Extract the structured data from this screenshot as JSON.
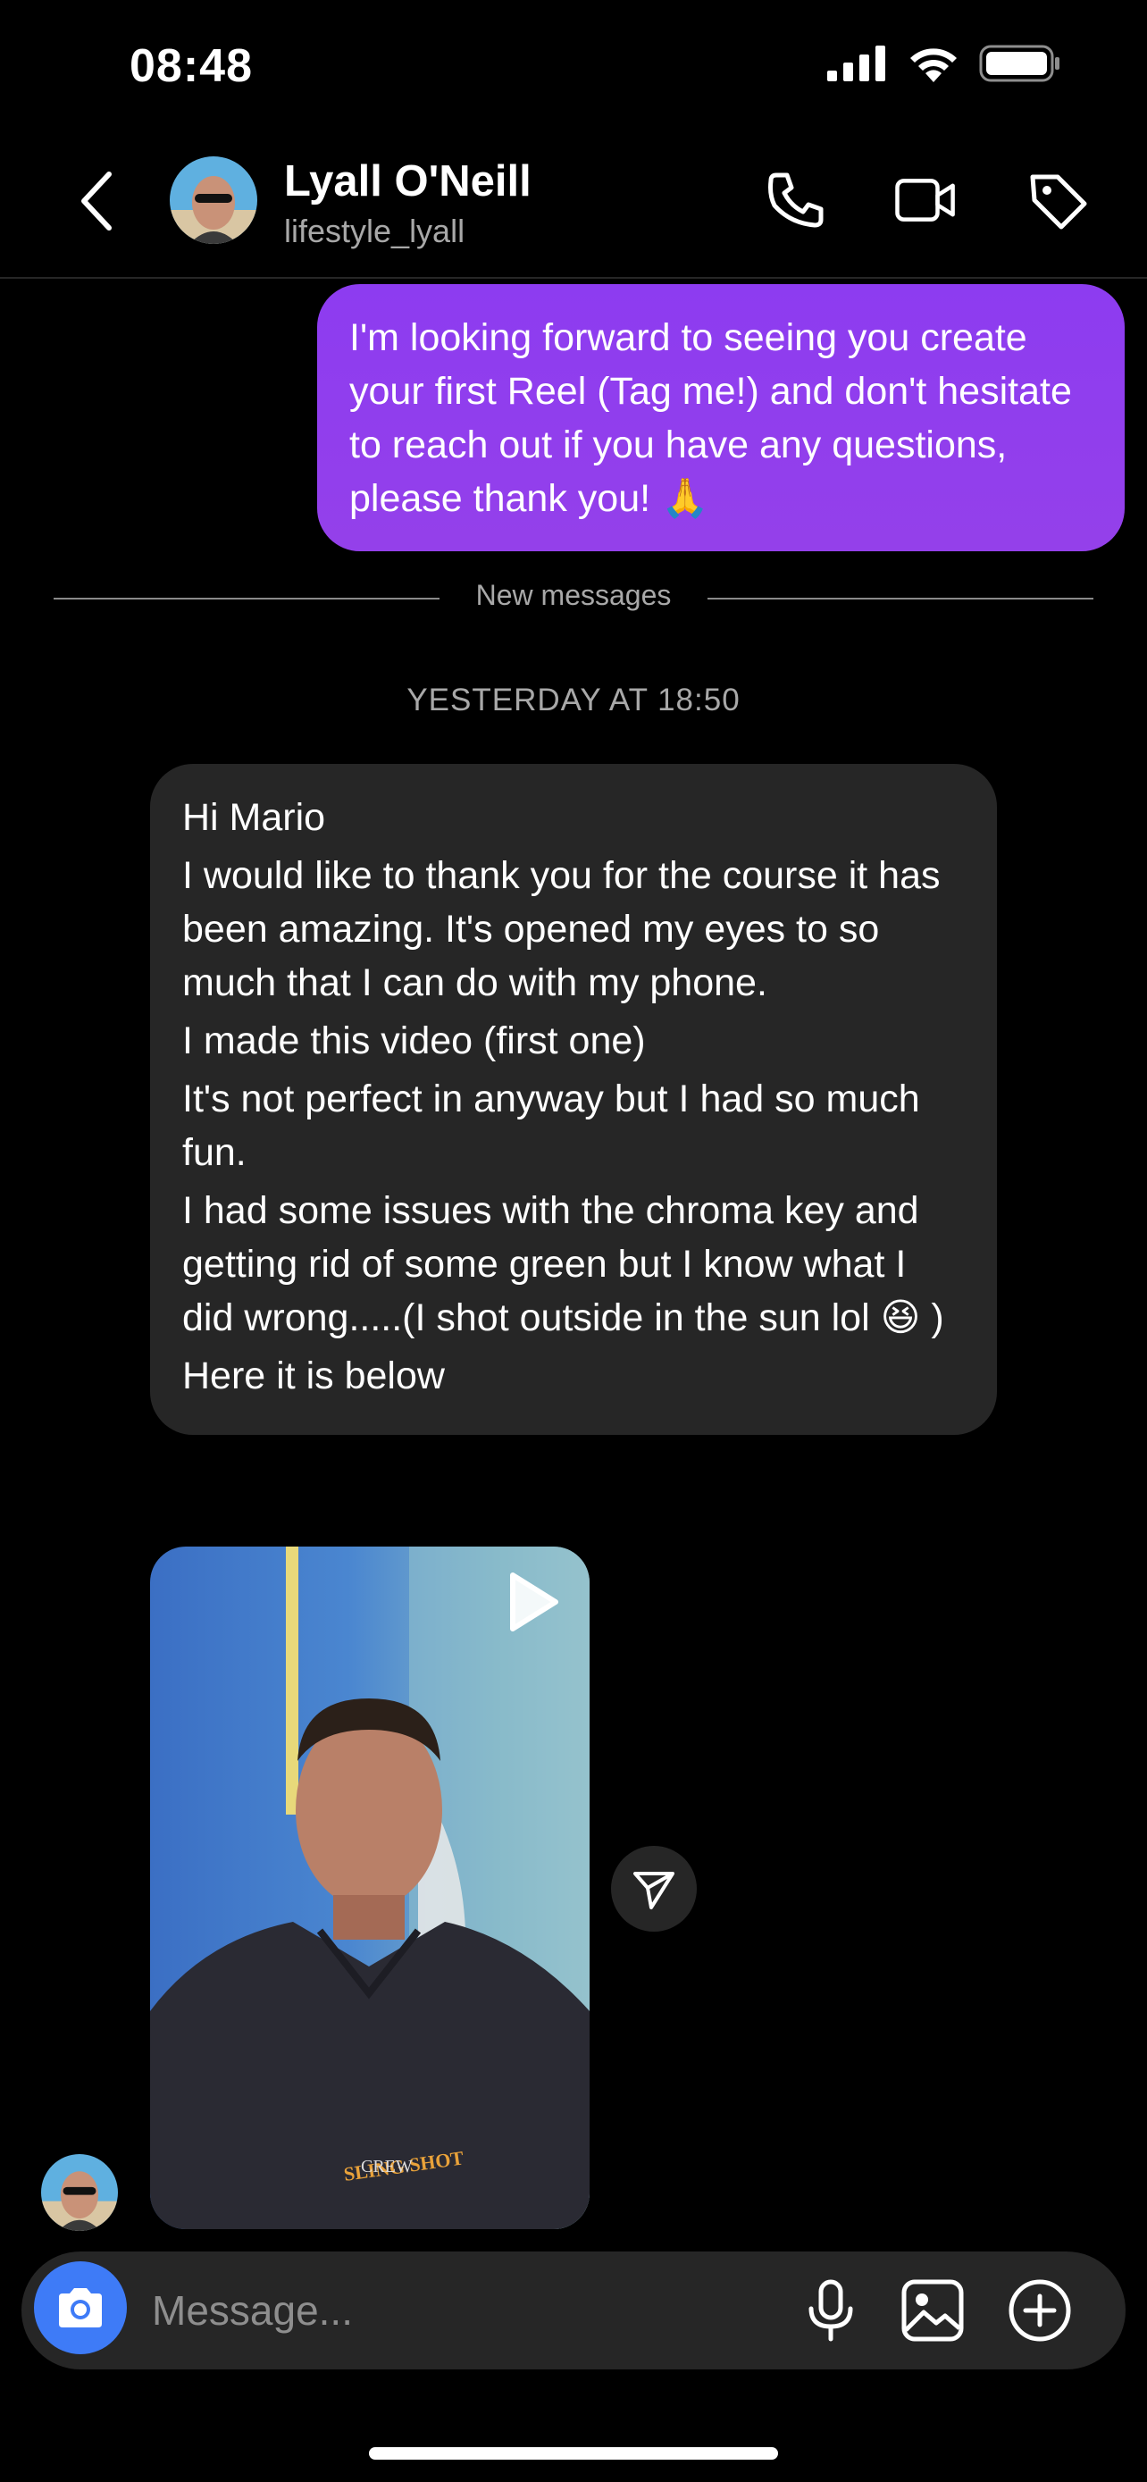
{
  "status": {
    "time": "08:48",
    "icons": [
      "cellular-signal-icon",
      "wifi-icon",
      "battery-icon"
    ]
  },
  "header": {
    "name": "Lyall O'Neill",
    "handle": "lifestyle_lyall",
    "icons": [
      "back-chevron-icon",
      "phone-icon",
      "video-call-icon",
      "tag-icon"
    ]
  },
  "messages": {
    "outgoing_text": "I'm looking forward to seeing you create your first Reel (Tag me!) and don't hesitate to reach out if you have any questions, please thank you! 🙏",
    "new_messages_label": "New messages",
    "timestamp": "YESTERDAY AT 18:50",
    "incoming_lines": [
      "Hi Mario",
      "I would like to thank you for the course it has been amazing. It's opened my eyes to so much that I can do with my phone.",
      "I made this video (first one)",
      "It's not perfect in anyway but I had so much fun.",
      "I had some issues with the chroma key and getting rid of some green but I know what I did wrong.....(I shot outside in the sun lol 😆 )",
      "Here it is below"
    ],
    "video_shirt_text": "SLING SHOT",
    "video_shirt_subtext": "CREW"
  },
  "composer": {
    "placeholder": "Message...",
    "icons": [
      "camera-icon",
      "microphone-icon",
      "gallery-icon",
      "add-circle-icon"
    ]
  },
  "colors": {
    "background": "#000000",
    "outgoing_bubble": "#9440ea",
    "incoming_bubble": "#262626",
    "camera_button": "#3e7bf7",
    "muted_text": "#a8a8a8"
  }
}
